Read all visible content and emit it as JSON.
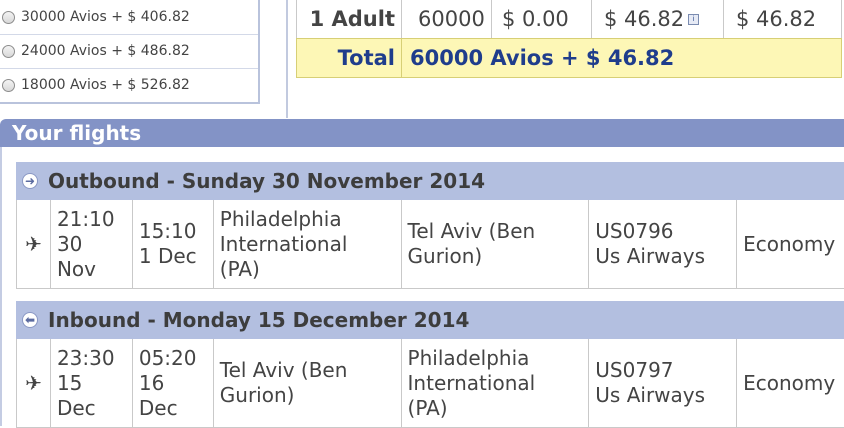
{
  "avios_options": [
    {
      "label": "30000 Avios + $ 406.82"
    },
    {
      "label": "24000 Avios + $ 486.82"
    },
    {
      "label": "18000 Avios + $ 526.82"
    }
  ],
  "price_table": {
    "row": {
      "passenger": "1 Adult",
      "avios": "60000",
      "cash": "$ 0.00",
      "taxes": "$ 46.82",
      "total": "$ 46.82"
    },
    "total": {
      "label": "Total",
      "value": "60000 Avios + $ 46.82"
    }
  },
  "your_flights": {
    "title": "Your flights",
    "legs": [
      {
        "heading": "Outbound - Sunday 30 November 2014",
        "depart_time": "21:10",
        "depart_day": "30",
        "depart_month": "Nov",
        "arrive_time": "15:10",
        "arrive_day": "1 Dec",
        "arrive_month": "",
        "from": [
          "Philadelphia",
          "International",
          "(PA)"
        ],
        "to": [
          "Tel Aviv (Ben",
          "Gurion)"
        ],
        "flight": "US0796",
        "airline": "Us Airways",
        "cabin": "Economy"
      },
      {
        "heading": "Inbound - Monday 15 December 2014",
        "depart_time": "23:30",
        "depart_day": "15",
        "depart_month": "Dec",
        "arrive_time": "05:20",
        "arrive_day": "16",
        "arrive_month": "Dec",
        "from": [
          "Tel Aviv (Ben",
          "Gurion)"
        ],
        "to": [
          "Philadelphia",
          "International",
          "(PA)"
        ],
        "flight": "US0797",
        "airline": "Us Airways",
        "cabin": "Economy"
      }
    ]
  }
}
